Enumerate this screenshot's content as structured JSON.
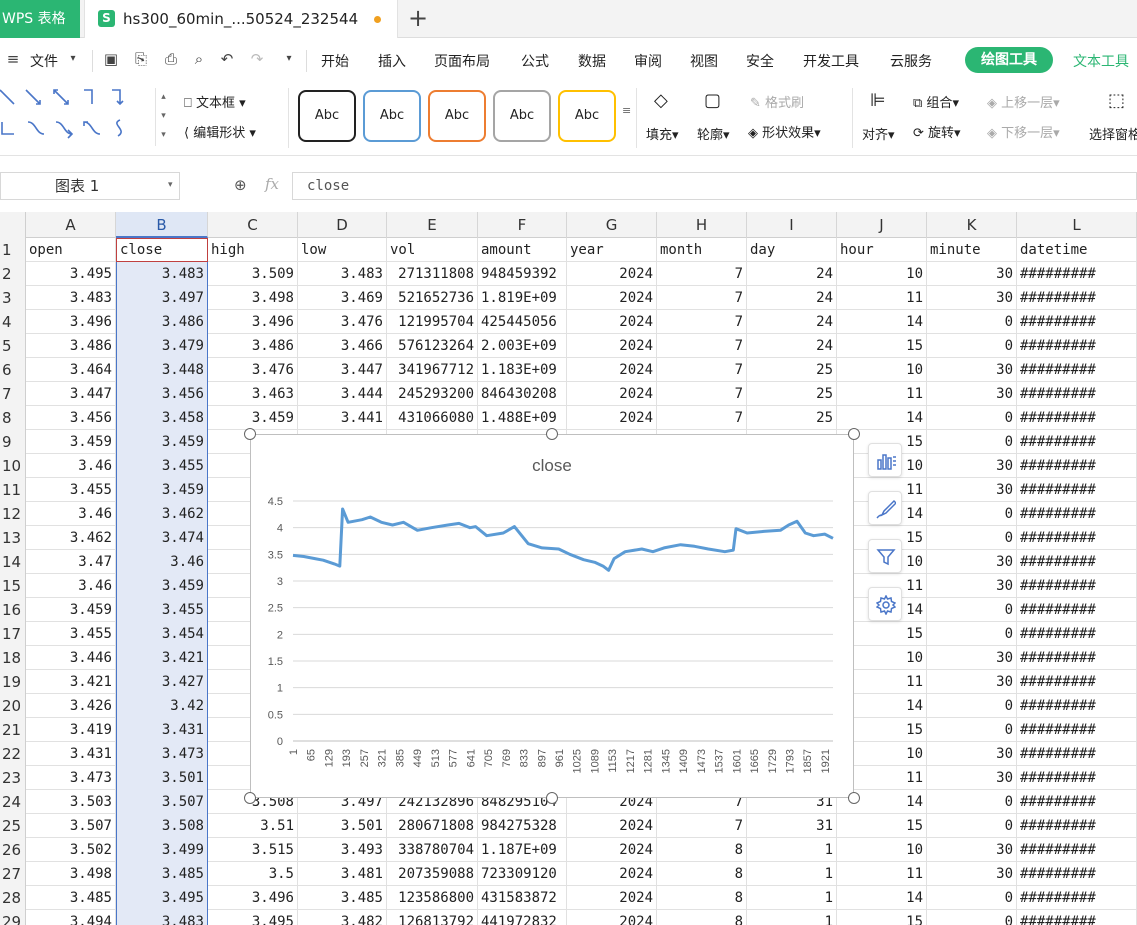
{
  "app": {
    "name": "WPS 表格"
  },
  "document_tab": {
    "title": "hs300_60min_...50524_232544"
  },
  "menu": {
    "file_label": "文件",
    "items": [
      "开始",
      "插入",
      "页面布局",
      "公式",
      "数据",
      "审阅",
      "视图",
      "安全",
      "开发工具",
      "云服务"
    ],
    "drawing_tools": "绘图工具",
    "text_tools": "文本工具"
  },
  "ribbon": {
    "textbox": "文本框",
    "edit_shape": "编辑形状",
    "style_label": "Abc",
    "style_colors": [
      "#222222",
      "#5b9bd5",
      "#ed7d31",
      "#a5a5a5",
      "#ffc000"
    ],
    "fill": "填充",
    "outline": "轮廓",
    "format_painter": "格式刷",
    "shape_effects": "形状效果",
    "align": "对齐",
    "group": "组合",
    "rotate": "旋转",
    "bring_forward": "上移一层",
    "send_backward": "下移一层",
    "selection_pane": "选择窗格"
  },
  "formula_bar": {
    "name_box": "图表 1",
    "fx": "fx",
    "content": "close"
  },
  "columns": [
    "A",
    "B",
    "C",
    "D",
    "E",
    "F",
    "G",
    "H",
    "I",
    "J",
    "K",
    "L"
  ],
  "headers": [
    "open",
    "close",
    "high",
    "low",
    "vol",
    "amount",
    "year",
    "month",
    "day",
    "hour",
    "minute",
    "datetime"
  ],
  "rows": [
    [
      "3.495",
      "3.483",
      "3.509",
      "3.483",
      "271311808",
      "948459392",
      "2024",
      "7",
      "24",
      "10",
      "30",
      "#########"
    ],
    [
      "3.483",
      "3.497",
      "3.498",
      "3.469",
      "521652736",
      "1.819E+09",
      "2024",
      "7",
      "24",
      "11",
      "30",
      "#########"
    ],
    [
      "3.496",
      "3.486",
      "3.496",
      "3.476",
      "121995704",
      "425445056",
      "2024",
      "7",
      "24",
      "14",
      "0",
      "#########"
    ],
    [
      "3.486",
      "3.479",
      "3.486",
      "3.466",
      "576123264",
      "2.003E+09",
      "2024",
      "7",
      "24",
      "15",
      "0",
      "#########"
    ],
    [
      "3.464",
      "3.448",
      "3.476",
      "3.447",
      "341967712",
      "1.183E+09",
      "2024",
      "7",
      "25",
      "10",
      "30",
      "#########"
    ],
    [
      "3.447",
      "3.456",
      "3.463",
      "3.444",
      "245293200",
      "846430208",
      "2024",
      "7",
      "25",
      "11",
      "30",
      "#########"
    ],
    [
      "3.456",
      "3.458",
      "3.459",
      "3.441",
      "431066080",
      "1.488E+09",
      "2024",
      "7",
      "25",
      "14",
      "0",
      "#########"
    ],
    [
      "3.459",
      "3.459",
      "",
      "",
      "",
      "",
      "",
      "",
      "",
      "15",
      "0",
      "#########"
    ],
    [
      "3.46",
      "3.455",
      "",
      "",
      "",
      "",
      "",
      "",
      "",
      "10",
      "30",
      "#########"
    ],
    [
      "3.455",
      "3.459",
      "",
      "",
      "",
      "",
      "",
      "",
      "",
      "11",
      "30",
      "#########"
    ],
    [
      "3.46",
      "3.462",
      "",
      "",
      "",
      "",
      "",
      "",
      "",
      "14",
      "0",
      "#########"
    ],
    [
      "3.462",
      "3.474",
      "",
      "",
      "",
      "",
      "",
      "",
      "",
      "15",
      "0",
      "#########"
    ],
    [
      "3.47",
      "3.46",
      "",
      "",
      "",
      "",
      "",
      "",
      "",
      "10",
      "30",
      "#########"
    ],
    [
      "3.46",
      "3.459",
      "",
      "",
      "",
      "",
      "",
      "",
      "",
      "11",
      "30",
      "#########"
    ],
    [
      "3.459",
      "3.455",
      "",
      "",
      "",
      "",
      "",
      "",
      "",
      "14",
      "0",
      "#########"
    ],
    [
      "3.455",
      "3.454",
      "",
      "",
      "",
      "",
      "",
      "",
      "",
      "15",
      "0",
      "#########"
    ],
    [
      "3.446",
      "3.421",
      "",
      "",
      "",
      "",
      "",
      "",
      "",
      "10",
      "30",
      "#########"
    ],
    [
      "3.421",
      "3.427",
      "",
      "",
      "",
      "",
      "",
      "",
      "",
      "11",
      "30",
      "#########"
    ],
    [
      "3.426",
      "3.42",
      "",
      "",
      "",
      "",
      "",
      "",
      "",
      "14",
      "0",
      "#########"
    ],
    [
      "3.419",
      "3.431",
      "",
      "",
      "",
      "",
      "",
      "",
      "",
      "15",
      "0",
      "#########"
    ],
    [
      "3.431",
      "3.473",
      "",
      "",
      "",
      "",
      "",
      "",
      "",
      "10",
      "30",
      "#########"
    ],
    [
      "3.473",
      "3.501",
      "",
      "",
      "",
      "",
      "",
      "",
      "",
      "11",
      "30",
      "#########"
    ],
    [
      "3.503",
      "3.507",
      "3.508",
      "3.497",
      "242132896",
      "848295104",
      "2024",
      "7",
      "31",
      "14",
      "0",
      "#########"
    ],
    [
      "3.507",
      "3.508",
      "3.51",
      "3.501",
      "280671808",
      "984275328",
      "2024",
      "7",
      "31",
      "15",
      "0",
      "#########"
    ],
    [
      "3.502",
      "3.499",
      "3.515",
      "3.493",
      "338780704",
      "1.187E+09",
      "2024",
      "8",
      "1",
      "10",
      "30",
      "#########"
    ],
    [
      "3.498",
      "3.485",
      "3.5",
      "3.481",
      "207359088",
      "723309120",
      "2024",
      "8",
      "1",
      "11",
      "30",
      "#########"
    ],
    [
      "3.485",
      "3.495",
      "3.496",
      "3.485",
      "123586800",
      "431583872",
      "2024",
      "8",
      "1",
      "14",
      "0",
      "#########"
    ],
    [
      "3.494",
      "3.483",
      "3.495",
      "3.482",
      "126813792",
      "441972832",
      "2024",
      "8",
      "1",
      "15",
      "0",
      "#########"
    ]
  ],
  "chart_data": {
    "type": "line",
    "title": "close",
    "series": [
      {
        "name": "close",
        "color": "#5b9bd5",
        "x": [
          1,
          40,
          80,
          110,
          150,
          170,
          180,
          200,
          250,
          280,
          320,
          360,
          400,
          450,
          500,
          560,
          600,
          640,
          660,
          700,
          760,
          800,
          850,
          900,
          960,
          1000,
          1050,
          1090,
          1120,
          1140,
          1160,
          1200,
          1260,
          1300,
          1340,
          1400,
          1450,
          1500,
          1560,
          1590,
          1600,
          1640,
          1700,
          1760,
          1790,
          1820,
          1850,
          1880,
          1920,
          1950
        ],
        "values": [
          3.48,
          3.46,
          3.42,
          3.39,
          3.32,
          3.28,
          4.35,
          4.1,
          4.15,
          4.2,
          4.1,
          4.05,
          4.1,
          3.95,
          4.0,
          4.05,
          4.08,
          4.0,
          4.02,
          3.85,
          3.9,
          4.02,
          3.7,
          3.62,
          3.6,
          3.5,
          3.4,
          3.35,
          3.28,
          3.2,
          3.42,
          3.55,
          3.6,
          3.55,
          3.62,
          3.68,
          3.65,
          3.6,
          3.55,
          3.58,
          3.98,
          3.9,
          3.93,
          3.95,
          4.05,
          4.12,
          3.9,
          3.85,
          3.88,
          3.8
        ]
      }
    ],
    "x_ticks": [
      1,
      65,
      129,
      193,
      257,
      321,
      385,
      449,
      513,
      577,
      641,
      705,
      769,
      833,
      897,
      961,
      1025,
      1089,
      1153,
      1217,
      1281,
      1345,
      1409,
      1473,
      1537,
      1601,
      1665,
      1729,
      1793,
      1857,
      1921
    ],
    "x_range": [
      1,
      1950
    ],
    "y_ticks": [
      "0",
      "0.5",
      "1",
      "1.5",
      "2",
      "2.5",
      "3",
      "3.5",
      "4",
      "4.5"
    ],
    "ylim": [
      0,
      4.5
    ],
    "grid": true,
    "legend": "none"
  },
  "chart_side_buttons": [
    "chart-elements-icon",
    "chart-style-icon",
    "chart-filter-icon",
    "chart-settings-icon"
  ]
}
